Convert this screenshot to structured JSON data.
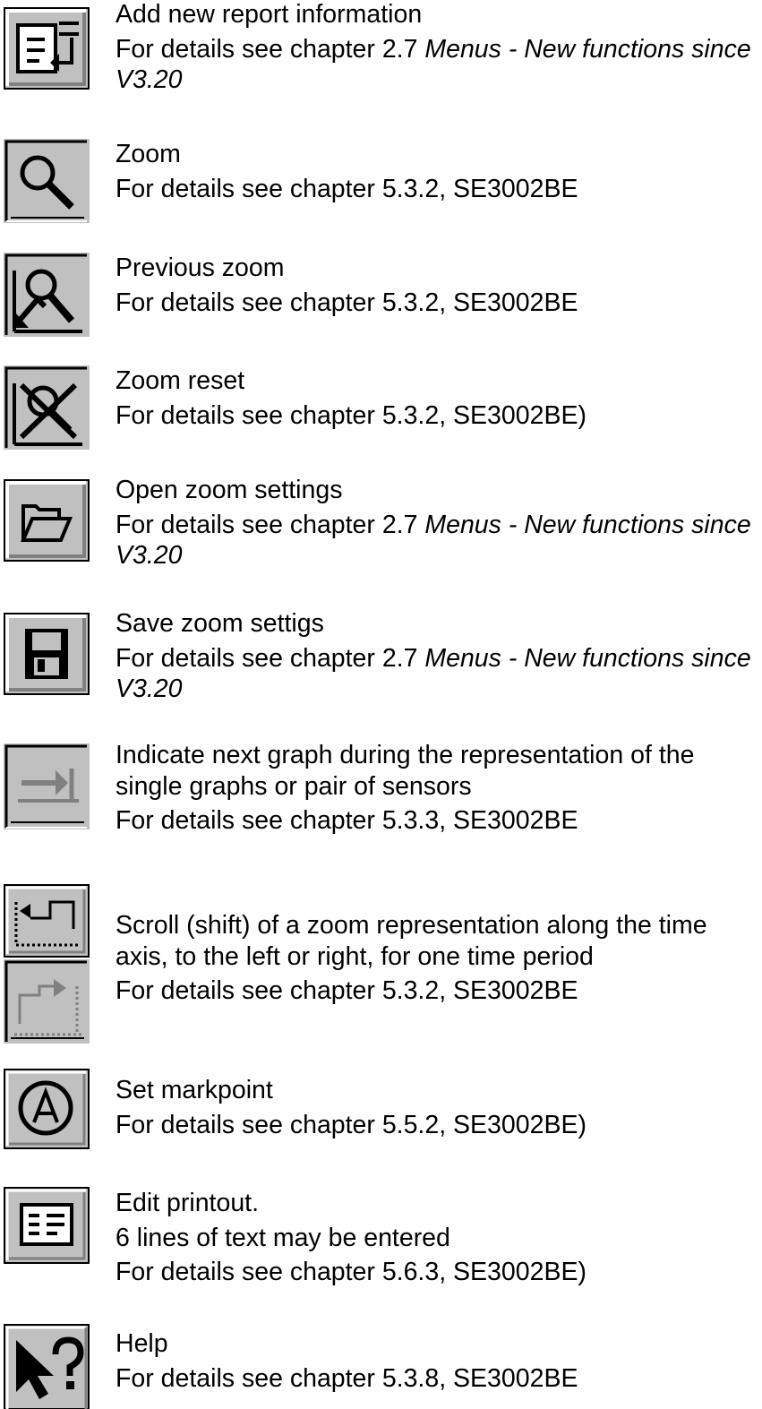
{
  "entries": [
    {
      "id": "add-report",
      "icon": "add-report-icon",
      "title": "Add new report information",
      "detail": "For details see chapter 2.7 ",
      "detail_italic": "Menus - New functions since V3.20"
    },
    {
      "id": "zoom",
      "icon": "zoom-icon",
      "title": "Zoom",
      "detail": "For details see chapter 5.3.2, SE3002BE"
    },
    {
      "id": "previous-zoom",
      "icon": "previous-zoom-icon",
      "title": "Previous zoom",
      "detail": "For details see chapter 5.3.2, SE3002BE"
    },
    {
      "id": "zoom-reset",
      "icon": "zoom-reset-icon",
      "title": "Zoom reset",
      "detail": "For details see chapter 5.3.2, SE3002BE)"
    },
    {
      "id": "open-zoom-settings",
      "icon": "open-folder-icon",
      "title": "Open zoom settings",
      "detail": "For details see chapter 2.7 ",
      "detail_italic": "Menus - New functions since V3.20"
    },
    {
      "id": "save-zoom-settings",
      "icon": "floppy-disk-icon",
      "title": "Save zoom settigs",
      "detail": "For details see chapter 2.7 ",
      "detail_italic": "Menus - New functions since V3.20"
    },
    {
      "id": "next-graph",
      "icon": "next-graph-icon",
      "title": "Indicate next graph during the representation of the single graphs or pair of sensors",
      "detail": "For details see chapter 5.3.3, SE3002BE"
    },
    {
      "id": "scroll-zoom",
      "icon": "scroll-left-icon",
      "icon2": "scroll-right-icon",
      "title": "Scroll (shift) of a zoom representation along the time axis, to the left or right, for one time period",
      "detail": "For details see chapter 5.3.2, SE3002BE"
    },
    {
      "id": "set-markpoint",
      "icon": "markpoint-icon",
      "title": "Set markpoint",
      "detail": "For details see chapter 5.5.2, SE3002BE)"
    },
    {
      "id": "edit-printout",
      "icon": "edit-printout-icon",
      "title": "Edit printout.",
      "extra": "6 lines of text may be entered",
      "detail": "For details see chapter 5.6.3, SE3002BE)"
    },
    {
      "id": "help",
      "icon": "help-pointer-icon",
      "title": "Help",
      "detail": "For details see chapter 5.3.8, SE3002BE"
    }
  ]
}
